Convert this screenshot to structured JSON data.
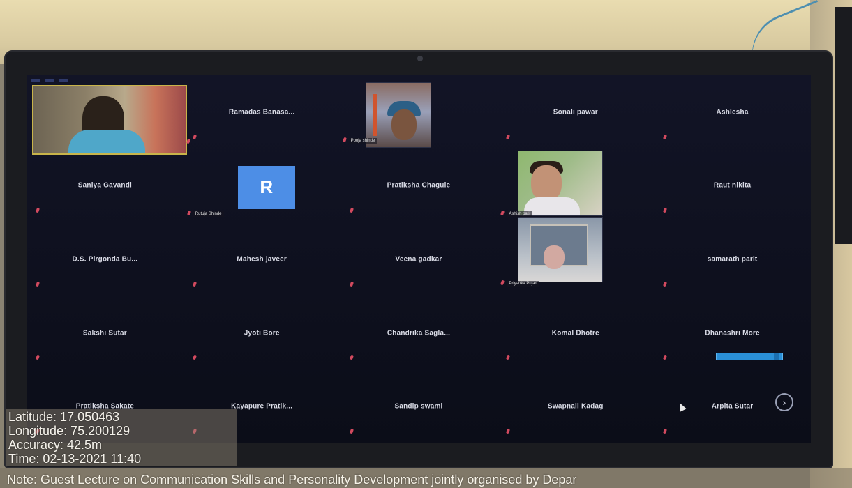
{
  "meeting": {
    "participants": [
      {
        "name": "",
        "caption": "",
        "video": "host"
      },
      {
        "name": "Ramadas Banasa...",
        "caption": ""
      },
      {
        "name": "",
        "caption": "Pooja shinde",
        "video": "pooja"
      },
      {
        "name": "Sonali pawar",
        "caption": ""
      },
      {
        "name": "Ashlesha",
        "caption": ""
      },
      {
        "name": "Saniya Gavandi",
        "caption": ""
      },
      {
        "name": "",
        "caption": "Rutuja Shinde",
        "avatar_letter": "R",
        "avatar_color": "#4d8ee6"
      },
      {
        "name": "Pratiksha Chagule",
        "caption": ""
      },
      {
        "name": "",
        "caption": "Ashish patil",
        "video": "ashish"
      },
      {
        "name": "Raut nikita",
        "caption": ""
      },
      {
        "name": "D.S. Pirgonda Bu...",
        "caption": ""
      },
      {
        "name": "Mahesh javeer",
        "caption": ""
      },
      {
        "name": "Veena gadkar",
        "caption": ""
      },
      {
        "name": "",
        "caption": "Priyanka Pujari",
        "video": "priyanka"
      },
      {
        "name": "samarath parit",
        "caption": ""
      },
      {
        "name": "Sakshi Sutar",
        "caption": ""
      },
      {
        "name": "Jyoti Bore",
        "caption": ""
      },
      {
        "name": "Chandrika Sagla...",
        "caption": ""
      },
      {
        "name": "Komal Dhotre",
        "caption": ""
      },
      {
        "name": "Dhanashri More",
        "caption": ""
      },
      {
        "name": "Pratiksha Sakate",
        "caption": ""
      },
      {
        "name": "Kayapure Pratik...",
        "caption": ""
      },
      {
        "name": "Sandip swami",
        "caption": ""
      },
      {
        "name": "Swapnali Kadag",
        "caption": ""
      },
      {
        "name": "Arpita Sutar",
        "caption": ""
      }
    ],
    "mic_muted_color": "#d24a5f",
    "next_page_icon": "chevron-right-icon"
  },
  "geotag": {
    "latitude": "Latitude: 17.050463",
    "longitude": "Longitude: 75.200129",
    "accuracy": "Accuracy: 42.5m",
    "time": "Time: 02-13-2021 11:40",
    "note": "Note: Guest Lecture on Communication Skills and Personality Development jointly organised by Depar"
  }
}
